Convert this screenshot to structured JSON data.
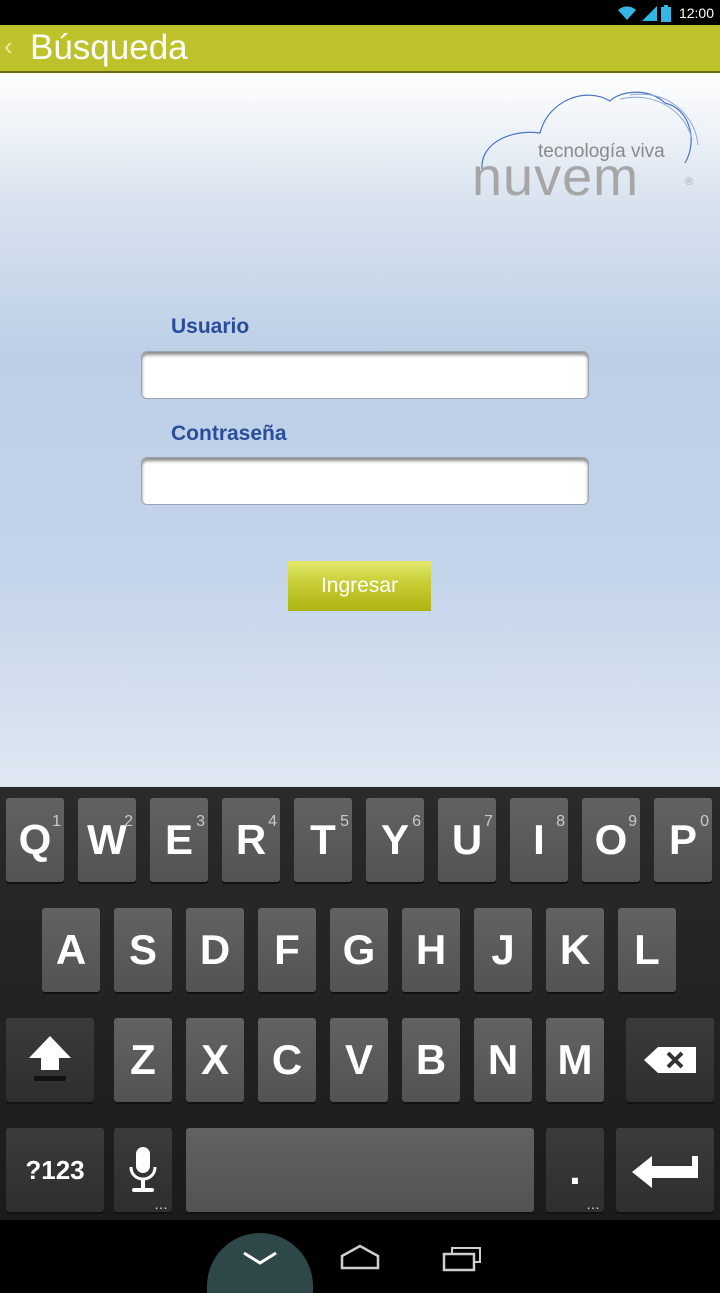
{
  "status_bar": {
    "time": "12:00"
  },
  "action_bar": {
    "back_icon": "chevron-left-icon",
    "title": "Búsqueda"
  },
  "logo": {
    "tagline": "tecnología viva",
    "brand": "nuvem"
  },
  "form": {
    "username_label": "Usuario",
    "username_value": "",
    "password_label": "Contraseña",
    "password_value": "",
    "submit_label": "Ingresar"
  },
  "keyboard": {
    "row1": [
      {
        "key": "Q",
        "hint": "1"
      },
      {
        "key": "W",
        "hint": "2"
      },
      {
        "key": "E",
        "hint": "3"
      },
      {
        "key": "R",
        "hint": "4"
      },
      {
        "key": "T",
        "hint": "5"
      },
      {
        "key": "Y",
        "hint": "6"
      },
      {
        "key": "U",
        "hint": "7"
      },
      {
        "key": "I",
        "hint": "8"
      },
      {
        "key": "O",
        "hint": "9"
      },
      {
        "key": "P",
        "hint": "0"
      }
    ],
    "row2": [
      "A",
      "S",
      "D",
      "F",
      "G",
      "H",
      "J",
      "K",
      "L"
    ],
    "row3": [
      "Z",
      "X",
      "C",
      "V",
      "B",
      "N",
      "M"
    ],
    "symbols_label": "?123",
    "period_label": ".",
    "icons": [
      "shift-icon",
      "backspace-icon",
      "microphone-icon",
      "enter-icon"
    ]
  },
  "nav_bar": {
    "icons": [
      "hide-keyboard-icon",
      "home-icon",
      "recent-apps-icon"
    ]
  },
  "colors": {
    "accent": "#bdc22a",
    "label": "#2a4d9b"
  }
}
